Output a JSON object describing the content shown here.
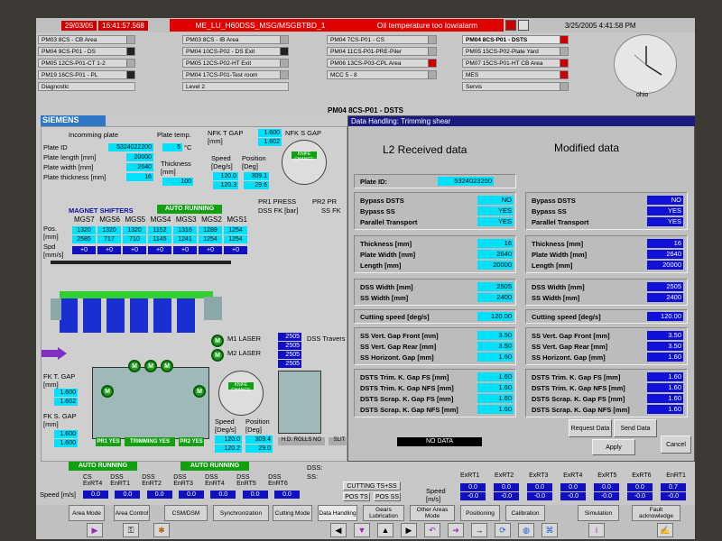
{
  "topbar": {
    "date": "29/03/05",
    "time": "16:41:57.568",
    "alarm_source": "ME_LU_H60DSS_MSG/MSGBTBD_1",
    "alarm_text": "Oil temperature too low/alarm",
    "clock_text": "3/25/2005 4:41:58 PM"
  },
  "nav": {
    "col1": [
      "PM03 8CS - CB Area",
      "PM04 9CS-P01 - DS",
      "PM05 12CS-P01-CT 1-2",
      "PM19 16CS-P01 - PL",
      "Diagnostic"
    ],
    "col2": [
      "PM03 8CS - IB Area",
      "PM04 10CS-P02 - DS Exit",
      "PM05 12CS-P02-HT Exit",
      "PM04 17CS-P01-Test room",
      "Level 2"
    ],
    "col3": [
      "PM04 7CS-P01 - CS",
      "PM04 11CS-P01-PRE-Piler",
      "PM06 13CS-P03-CPL Area",
      "MCC 5 - 8"
    ],
    "col4": [
      "PM04 8CS-P01 - DSTS",
      "PM05 15CS-P02-Plate Yard",
      "PM07 15CS-P01-HT CB Area",
      "MES",
      "Servis"
    ],
    "clock_label": "ohio"
  },
  "title": "PM04 8CS-P01 - DSTS",
  "siemens": "SIEMENS",
  "left": {
    "incoming_title": "Incomming plate",
    "plate_id_label": "Plate ID",
    "plate_id": "5324022200",
    "plate_length_label": "Plate length [mm]",
    "plate_length": "20000",
    "plate_width_label": "Plate width [mm]",
    "plate_width": "2640",
    "plate_thickness_label": "Plate thickness [mm]",
    "plate_thickness": "16",
    "plate_temp_label": "Plate temp.",
    "plate_temp": "5",
    "plate_temp_unit": "°C",
    "thickness_label": "Thickness [mm]",
    "thickness": "100",
    "nfk_t_gap_label": "NFK T GAP [mm]",
    "nfk_t_gap_1": "1.600",
    "nfk_t_gap_2": "1.602",
    "nfk_s_gap_label": "NFK S GAP",
    "speed_label": "Speed [Deg/s]",
    "position_label": "Position [Deg]",
    "speed_1": "120.0",
    "speed_2": "120.3",
    "position_1": "309.1",
    "position_2": "29.6",
    "gauge_label": "KNIFE CHANGE",
    "pr1_press": "PR1 PRESS",
    "pr2_pr": "PR2 PR",
    "dss_fk_bar": "DSS FK [bar]",
    "dss_sfk": "SS FK",
    "magnet_title": "MAGNET SHIFTERS",
    "auto_running": "AUTO RUNNING",
    "mg_headers": [
      "MGS7",
      "MGS6",
      "MGS5",
      "MGS4",
      "MGS3",
      "MGS2",
      "MGS1"
    ],
    "pos_label": "Pos. [mm]",
    "spd_label": "Spd [mm/s]",
    "mg_pos": [
      "1320",
      "1320",
      "1320",
      "1152",
      "1316",
      "1289",
      "1254"
    ],
    "mg_spd": [
      "2585",
      "717",
      "710",
      "1145",
      "1241",
      "1254",
      "1254"
    ],
    "mg_zero": [
      "+0",
      "+0",
      "+0",
      "+0",
      "+0",
      "+0",
      "+0"
    ],
    "fk_t_gap_label": "FK T. GAP [mm]",
    "fk_t_gap_1": "1.600",
    "fk_t_gap_2": "1.602",
    "fk_s_gap_label": "FK S. GAP [mm]",
    "fk_s_gap_1": "1.600",
    "fk_s_gap_2": "1.600",
    "m1_laser": "M1 LASER",
    "m2_laser": "M2 LASER",
    "laser_vals": [
      "2505",
      "2505",
      "2505",
      "2505"
    ],
    "dss_travers": "DSS Travers",
    "speed2_1": "120.0",
    "speed2_2": "120.2",
    "pos2_1": "309.4",
    "pos2_2": "29.0",
    "pr1_yes": "PR1 YES",
    "trimming_yes": "TRIMMING YES",
    "pr2_yes": "PR2 YES",
    "hd_rolls_no": "H.D. ROLLS NO",
    "slit": "SLIT",
    "gauge_ticks": [
      "0",
      "90",
      "270",
      "211.5"
    ]
  },
  "dialog": {
    "title": "Data Handling: Trimming shear",
    "l2_header": "L2 Received data",
    "mod_header": "Modified data",
    "plate_id_label": "Plate ID:",
    "plate_id": "5324023200",
    "rows1": [
      {
        "label": "Bypass DSTS",
        "l2": "NO",
        "mod": "NO"
      },
      {
        "label": "Bypass SS",
        "l2": "YES",
        "mod": "YES"
      },
      {
        "label": "Parallel Transport",
        "l2": "YES",
        "mod": "YES"
      }
    ],
    "rows2": [
      {
        "label": "Thickness [mm]",
        "l2": "16",
        "mod": "16"
      },
      {
        "label": "Plate Width [mm]",
        "l2": "2640",
        "mod": "2640"
      },
      {
        "label": "Length [mm]",
        "l2": "20000",
        "mod": "20000"
      }
    ],
    "rows3": [
      {
        "label": "DSS Width [mm]",
        "l2": "2505",
        "mod": "2505"
      },
      {
        "label": "SS Width [mm]",
        "l2": "2400",
        "mod": "2400"
      }
    ],
    "rows4": [
      {
        "label": "Cutting speed [deg/s]",
        "l2": "120.00",
        "mod": "120.00"
      }
    ],
    "rows5": [
      {
        "label": "SS Vert. Gap Front [mm]",
        "l2": "3.50",
        "mod": "3.50"
      },
      {
        "label": "SS Vert. Gap Rear [mm]",
        "l2": "3.50",
        "mod": "3.50"
      },
      {
        "label": "SS Horizont. Gap [mm]",
        "l2": "1.60",
        "mod": "1.60"
      }
    ],
    "rows6": [
      {
        "label": "DSTS Trim. K. Gap FS [mm]",
        "l2": "1.60",
        "mod": "1.60"
      },
      {
        "label": "DSTS Trim. K. Gap NFS [mm]",
        "l2": "1.60",
        "mod": "1.60"
      },
      {
        "label": "DSTS Scrap. K. Gap FS [mm]",
        "l2": "1.60",
        "mod": "1.60"
      },
      {
        "label": "DSTS Scrap. K. Gap NFS [mm]",
        "l2": "1.60",
        "mod": "1.60"
      }
    ],
    "no_data": "NO DATA",
    "request": "Request Data",
    "send": "Send Data",
    "apply": "Apply",
    "cancel": "Cancel"
  },
  "bottom": {
    "auto1": "AUTO RUNNING",
    "auto2": "AUTO RUNNING",
    "cs_hdr": "CS ExRT4",
    "dss_hdr": "DSS EnRT1",
    "ss_hdr": "SS EnRT1",
    "hdrs": [
      "CS ExRT4",
      "DSS EnRT1",
      "DSS EnRT2",
      "DSS EnRT3",
      "DSS EnRT4",
      "DSS EnRT5",
      "DSS EnRT6"
    ],
    "speed_label": "Speed [m/s]",
    "vals": [
      "0.0",
      "0.0",
      "0.0",
      "0.0",
      "0.0",
      "0.0",
      "0.0"
    ],
    "dss": "DSS:",
    "ss": "SS:",
    "cutting_ts_ss": "CUTTING TS+SS",
    "pos_ts": "POS TS",
    "pos_ss": "POS SS",
    "right_hdrs": [
      "ExRT1",
      "ExRT2",
      "ExRT3",
      "ExRT4",
      "ExRT5",
      "ExRT6",
      "EnRT1"
    ],
    "right_vals": [
      "0.0",
      "0.0",
      "0.0",
      "0.0",
      "0.0",
      "0.0",
      "0.7"
    ],
    "right_neg": [
      "-0.0",
      "-0.0",
      "-0.0",
      "-0.0",
      "-0.0",
      "-0.0",
      "-0.0"
    ],
    "speed_label2": "Speed [m/s]"
  },
  "menu": [
    "Area Mode",
    "Area Control",
    "CSM/DSM",
    "Synchronization",
    "Cutting Mode",
    "Data Handling",
    "Gears Lubrication",
    "Other Areas Mode",
    "Positioning",
    "Calibration",
    "Simulation",
    "Fault acknowledge"
  ]
}
